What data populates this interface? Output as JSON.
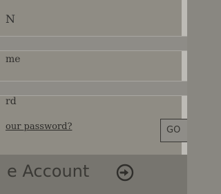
{
  "login": {
    "heading": "N",
    "username_label": "me",
    "password_label": "rd",
    "forgot_link": "our password?",
    "go_label": "GO"
  },
  "create": {
    "label": "e Account",
    "icon": "arrow-right-circle-icon"
  },
  "colors": {
    "panel_bg": "#8f8c84",
    "bottom_bar_bg": "#77756f",
    "text": "#2f2f2f"
  }
}
